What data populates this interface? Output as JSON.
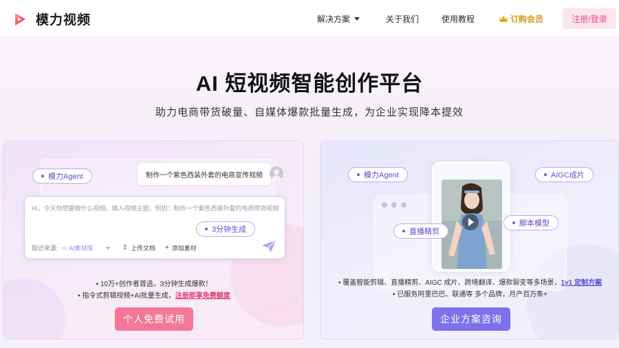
{
  "brand": {
    "name": "模力视频"
  },
  "nav": {
    "solutions": "解决方案",
    "about": "关于我们",
    "tutorial": "使用教程",
    "vip": "订购会员",
    "login": "注册/登录"
  },
  "hero": {
    "title": "AI 短视频智能创作平台",
    "subtitle": "助力电商带货破量、自媒体爆款批量生成，为企业实现降本提效"
  },
  "left_card": {
    "agent_pill": "模力Agent",
    "chat_prompt": "制作一个紫色西装外套的电商宣传视频",
    "input_placeholder": "Hi，今天你想要做什么视频，输入视频主题，例如：制作一个紫色西装外套的电商带货视频",
    "speed_pill": "3分钟生成",
    "source_label": "知识来源:",
    "source_value": "AI素材库",
    "upload_label": "上传文档",
    "add_label": "添加素材",
    "line1": "10万+创作者首选，3分钟生成爆款！",
    "line2_prefix": "指令式剪辑视频+AI批量生成，",
    "line2_link": "注册即享免费额度",
    "cta": "个人免费试用"
  },
  "right_card": {
    "agent_pill": "模力Agent",
    "aigc_pill": "AIGC成片",
    "live_pill": "直播精剪",
    "script_pill": "脚本模型",
    "line1_prefix": "覆盖智能剪辑、直播精剪、AIGC 成片、跨境翻译、爆款裂变等多场景，",
    "line1_link": "1v1 定制方案",
    "line2": "已服务阿里巴巴、联通等 多个品牌，月产百万条+",
    "cta": "企业方案咨询"
  },
  "colors": {
    "accent_pink": "#f37898",
    "accent_purple": "#7c72ec",
    "vip_gold": "#d99a1e",
    "promo_red": "#e23a6c"
  }
}
